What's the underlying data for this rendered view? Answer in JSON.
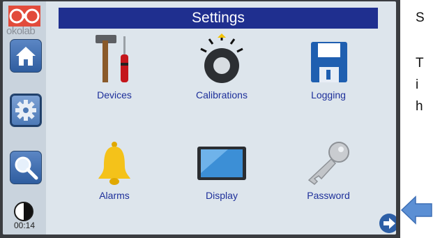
{
  "sidebar": {
    "logo_text": "okolab",
    "timer": "00:14",
    "buttons": [
      {
        "name": "home",
        "icon": "home-icon"
      },
      {
        "name": "settings",
        "icon": "gear-icon"
      },
      {
        "name": "search",
        "icon": "search-icon"
      }
    ]
  },
  "header": {
    "title": "Settings"
  },
  "grid": {
    "items": [
      {
        "label": "Devices",
        "icon": "tools-icon"
      },
      {
        "label": "Calibrations",
        "icon": "dial-icon"
      },
      {
        "label": "Logging",
        "icon": "floppy-disk-icon"
      },
      {
        "label": "Alarms",
        "icon": "bell-icon"
      },
      {
        "label": "Display",
        "icon": "tablet-icon"
      },
      {
        "label": "Password",
        "icon": "key-icon"
      }
    ]
  },
  "annotation": {
    "lines": [
      "S",
      "T",
      "i",
      "h"
    ],
    "accent": "#5b8fd4"
  },
  "colors": {
    "title_bar": "#1f2f8f",
    "label": "#1d2f9a",
    "button": "#2f5d9f"
  }
}
